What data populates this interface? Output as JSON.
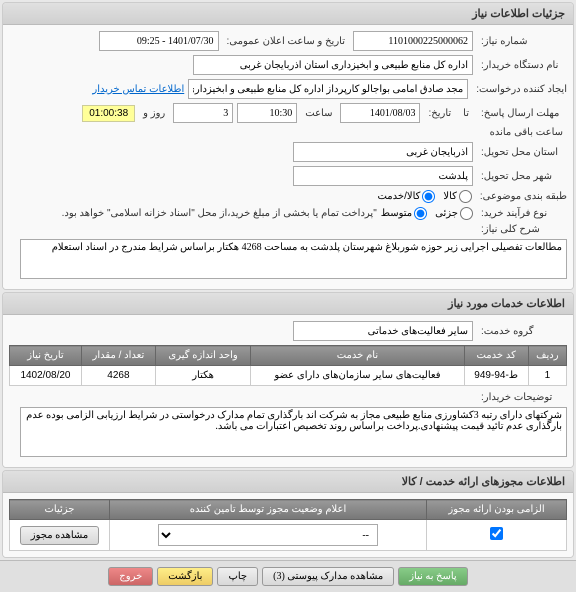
{
  "top_panel": {
    "title": "جزئیات اطلاعات نیاز",
    "req_no_lbl": "شماره نیاز:",
    "req_no": "1101000225000062",
    "announce_lbl": "تاریخ و ساعت اعلان عمومی:",
    "announce": "1401/07/30 - 09:25",
    "buyer_lbl": "نام دستگاه خریدار:",
    "buyer": "اداره کل منابع طبیعی و آبخیزداری استان آذربایجان غربی",
    "creator_lbl": "ایجاد کننده درخواست:",
    "creator": "مجد صادق امامی بواجالو کارپرداز اداره کل منابع طبیعی و آبخیزداری استان آذربا",
    "contact_link": "اطلاعات تماس خریدار",
    "deadline_lbl": "مهلت ارسال پاسخ:",
    "date_lbl": "تاریخ:",
    "deadline_date": "1401/08/03",
    "time_lbl": "ساعت",
    "deadline_time": "10:30",
    "days_left": "3",
    "day_lbl": "روز و",
    "timer": "01:00:38",
    "timer_lbl": "ساعت باقی مانده",
    "until_lbl": "تا",
    "province_lbl": "استان محل تحویل:",
    "province": "آذربایجان غربی",
    "city_lbl": "شهر محل تحویل:",
    "city": "پلدشت",
    "category_lbl": "طبقه بندی موضوعی:",
    "cat_goods": "کالا",
    "cat_service": "کالا/خدمت",
    "buy_process_lbl": "نوع فرآیند خرید:",
    "proc_partial": "جزئی",
    "proc_medium": "متوسط",
    "proc_note": "\"پرداخت تمام یا بخشی از مبلغ خرید،از محل \"اسناد خزانه اسلامی\" خواهد بود.",
    "desc_lbl": "شرح کلی نیاز:",
    "desc": "مطالعات تفصیلی اجرایی زیر حوزه شوربلاغ شهرستان پلدشت به مساحت 4268 هکتار براساس شرایط مندرج در اسناد استعلام"
  },
  "services_panel": {
    "title": "اطلاعات خدمات مورد نیاز",
    "group_lbl": "گروه خدمت:",
    "group": "سایر فعالیت‌های خدماتی",
    "table": {
      "headers": [
        "ردیف",
        "کد خدمت",
        "نام خدمت",
        "واحد اندازه گیری",
        "تعداد / مقدار",
        "تاریخ نیاز"
      ],
      "rows": [
        [
          "1",
          "ط-94-949",
          "فعالیت‌های سایر سازمان‌های دارای عضو",
          "هکتار",
          "4268",
          "1402/08/20"
        ]
      ]
    },
    "notes_lbl": "توضیحات خریدار:",
    "notes": "شرکتهای دارای رتبه 3کشاورزی منابع طبیعی مجاز به شرکت اند بارگذاری تمام مدارک درخواستی در شرایط ارزیابی الزامی بوده عدم بارگذاری عدم تائید قیمت پیشنهادی.پرداخت براساس روند تخصیص اعتبارات می باشد."
  },
  "permits_panel": {
    "title": "اطلاعات مجوزهای ارائه خدمت / کالا",
    "table": {
      "headers": [
        "الزامی بودن ارائه مجوز",
        "اعلام وضعیت مجوز توسط تامین کننده",
        "جزئیات"
      ],
      "select_placeholder": "--",
      "view_btn": "مشاهده مجوز"
    }
  },
  "footer": {
    "reply": "پاسخ به نیاز",
    "attachments": "مشاهده مدارک پیوستی (3)",
    "print": "چاپ",
    "back": "بازگشت",
    "exit": "خروج"
  }
}
